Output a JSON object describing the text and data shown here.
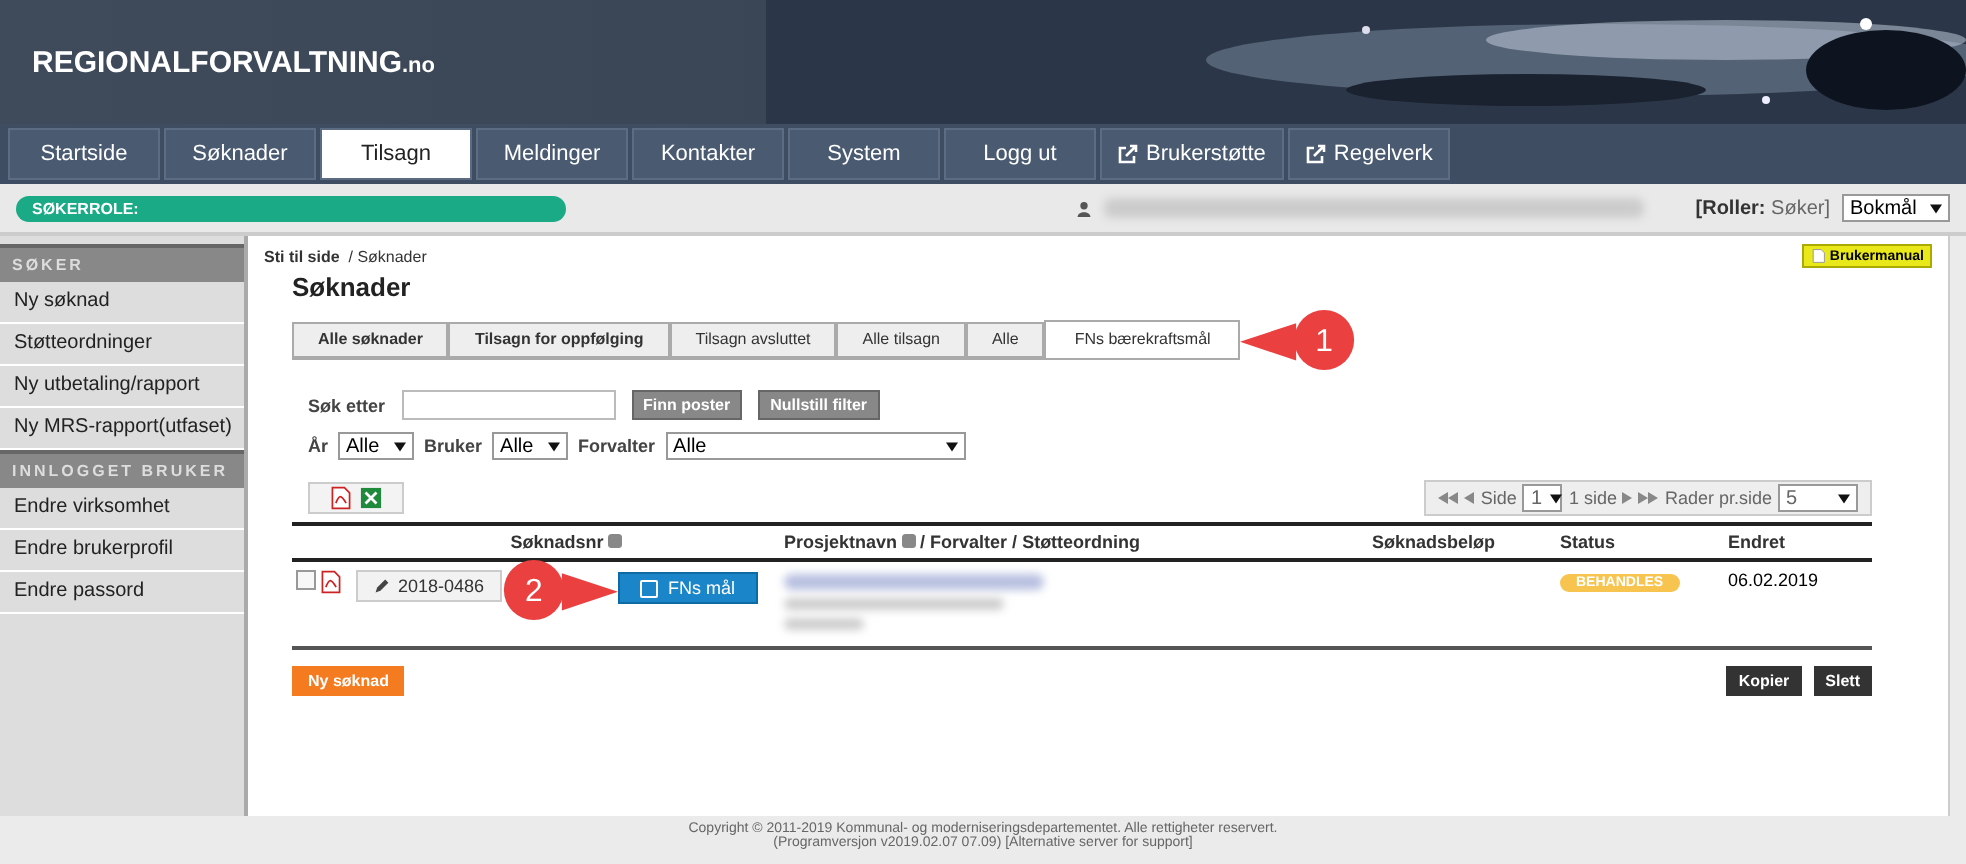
{
  "header": {
    "logo": "REGIONALFORVALTNING",
    "logo_suffix": ".no"
  },
  "nav": [
    {
      "label": "Startside",
      "selected": false,
      "external": false
    },
    {
      "label": "Søknader",
      "selected": false,
      "external": false
    },
    {
      "label": "Tilsagn",
      "selected": true,
      "external": false
    },
    {
      "label": "Meldinger",
      "selected": false,
      "external": false
    },
    {
      "label": "Kontakter",
      "selected": false,
      "external": false
    },
    {
      "label": "System",
      "selected": false,
      "external": false
    },
    {
      "label": "Logg ut",
      "selected": false,
      "external": false
    },
    {
      "label": "Brukerstøtte",
      "selected": false,
      "external": true
    },
    {
      "label": "Regelverk",
      "selected": false,
      "external": true
    }
  ],
  "role_bar": {
    "role_label": "SØKERROLE:",
    "roles_prefix": "[Roller:",
    "roles_value": "Søker]",
    "language": "Bokmål"
  },
  "sidebar": [
    {
      "heading": "SØKER",
      "items": [
        "Ny søknad",
        "Støtteordninger",
        "Ny utbetaling/rapport",
        "Ny MRS-rapport(utfaset)"
      ]
    },
    {
      "heading": "INNLOGGET BRUKER",
      "items": [
        "Endre virksomhet",
        "Endre brukerprofil",
        "Endre passord"
      ]
    }
  ],
  "breadcrumb": {
    "root": "Sti til side",
    "separator": "/",
    "current": "Søknader"
  },
  "manual_button": "Brukermanual",
  "title": "Søknader",
  "tabs": [
    {
      "label": "Alle søknader",
      "selected": false,
      "bold": true
    },
    {
      "label": "Tilsagn for oppfølging",
      "selected": false,
      "bold": true
    },
    {
      "label": "Tilsagn avsluttet",
      "selected": false,
      "bold": false
    },
    {
      "label": "Alle tilsagn",
      "selected": false,
      "bold": false
    },
    {
      "label": "Alle",
      "selected": false,
      "bold": false
    },
    {
      "label": "FNs bærekraftsmål",
      "selected": true,
      "bold": false
    }
  ],
  "search": {
    "label": "Søk etter",
    "find_button": "Finn poster",
    "reset_button": "Nullstill filter"
  },
  "filters": [
    {
      "label": "År",
      "value": "Alle",
      "wide": false
    },
    {
      "label": "Bruker",
      "value": "Alle",
      "wide": false
    },
    {
      "label": "Forvalter",
      "value": "Alle",
      "wide": true
    }
  ],
  "pager": {
    "side_label": "Side",
    "page": "1",
    "pages": "1 side",
    "rows_label": "Rader pr.side",
    "rows": "5"
  },
  "table": {
    "columns": [
      "Søknadsnr",
      "Prosjektnavn",
      "/ Forvalter / Støtteordning",
      "Søknadsbeløp",
      "Status",
      "Endret"
    ],
    "rows": [
      {
        "checked": false,
        "number": "2018-0486",
        "goal_button": "FNs mål",
        "status": "BEHANDLES",
        "changed": "06.02.2019"
      }
    ]
  },
  "new_button": "Ny søknad",
  "copy_button": "Kopier",
  "delete_button": "Slett",
  "callouts": [
    "1",
    "2"
  ],
  "footer": [
    "Copyright © 2011-2019 Kommunal- og moderniseringsdepartementet. Alle rettigheter reservert.",
    "(Programversjon v2019.02.07 07.09) [Alternative server for support]"
  ]
}
